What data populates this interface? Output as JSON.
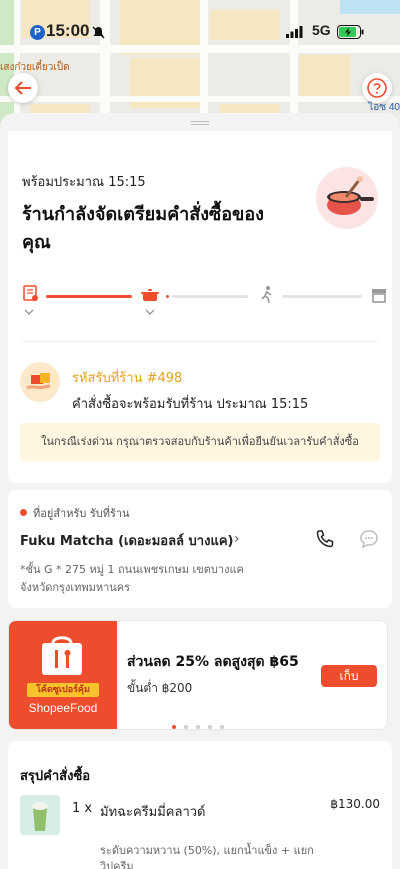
{
  "status_bar": {
    "time": "15:00",
    "network": "5G"
  },
  "map": {
    "label_left": "เสงก๋วยเตี๋ยวเป็ด",
    "label_right": "ไอซ 40"
  },
  "order_status": {
    "eta": "พร้อมประมาณ 15:15",
    "headline": "ร้านกำลังจัดเตรียมคำสั่งซื้อของคุณ",
    "progress_steps": [
      "receipt-icon",
      "cooking-pot-icon",
      "walking-person-icon",
      "store-icon"
    ],
    "current_step": 2
  },
  "pickup": {
    "code_label": "รหัสรับที่ร้าน #498",
    "ready_text": "คำสั่งซื้อจะพร้อมรับที่ร้าน ประมาณ 15:15",
    "notice": "ในกรณีเร่งด่วน กรุณาตรวจสอบกับร้านค้าเพื่อยืนยันเวลารับคำสั่งซื้อ"
  },
  "store": {
    "address_type": "ที่อยู่สำหรับ รับที่ร้าน",
    "name": "Fuku Matcha (เดอะมอลล์ บางแค)",
    "address_line1": "*ชั้น G * 275 หมู่ 1 ถนนเพชรเกษม เขตบางแค",
    "address_line2": "จังหวัดกรุงเทพมหานคร"
  },
  "promo": {
    "badge": "โค้ดซูเปอร์คุ้ม",
    "brand": "ShopeeFood",
    "title": "ส่วนลด 25% ลดสูงสุด ฿65",
    "min_spend": "ขั้นต่ำ ฿200",
    "button": "เก็บ"
  },
  "summary": {
    "title": "สรุปคำสั่งซื้อ",
    "items": [
      {
        "qty": "1 x",
        "name": "มัทฉะครีมมี่คลาวด์",
        "price": "฿130.00",
        "options_line1": "ระดับความหวาน (50%), แยกน้ำแข็ง + แยก",
        "options_line2": "วิปครีม"
      }
    ]
  },
  "colors": {
    "accent": "#ee4d2d",
    "gold": "#e5a21b"
  }
}
